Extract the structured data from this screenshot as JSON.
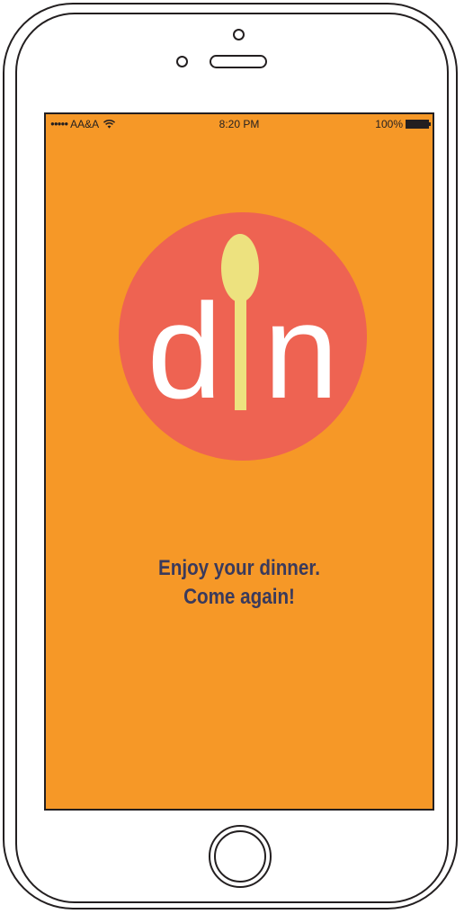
{
  "status_bar": {
    "signal": "●●●●●",
    "carrier": "AA&A",
    "time": "8:20 PM",
    "battery_percent": "100%"
  },
  "logo": {
    "letter_left": "d",
    "letter_right": "n",
    "circle_color": "#ee6352",
    "spoon_color": "#ede27f",
    "letter_color": "#ffffff"
  },
  "message": {
    "line1": "Enjoy your dinner.",
    "line2": "Come again!"
  },
  "colors": {
    "screen_background": "#f69827",
    "text": "#3a3a5c"
  }
}
